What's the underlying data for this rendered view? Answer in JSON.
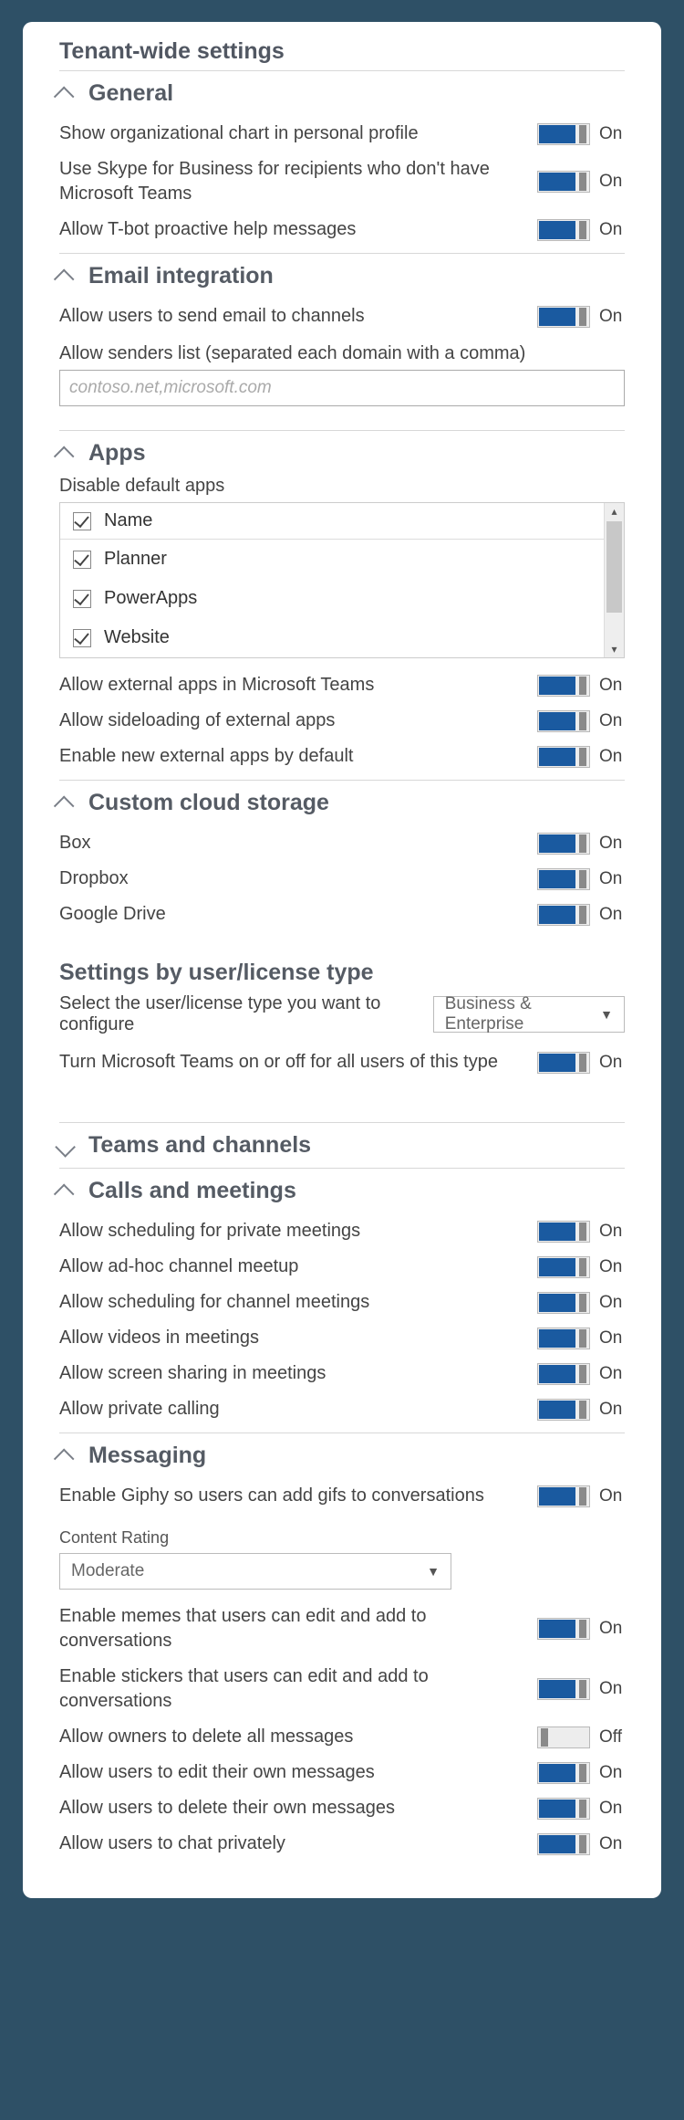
{
  "title": "Tenant-wide settings",
  "toggle_on_text": "On",
  "toggle_off_text": "Off",
  "sections": {
    "general": {
      "heading": "General",
      "items": [
        {
          "label": "Show organizational chart in personal profile",
          "state": "on"
        },
        {
          "label": "Use Skype for Business for recipients who don't have Microsoft Teams",
          "state": "on"
        },
        {
          "label": "Allow T-bot proactive help messages",
          "state": "on"
        }
      ]
    },
    "email": {
      "heading": "Email integration",
      "items": [
        {
          "label": "Allow users to send email to channels",
          "state": "on"
        }
      ],
      "senders_label": "Allow senders list (separated each domain with a comma)",
      "senders_placeholder": "contoso.net,microsoft.com"
    },
    "apps": {
      "heading": "Apps",
      "disable_label": "Disable default apps",
      "name_header": "Name",
      "list": [
        {
          "name": "Planner",
          "checked": true
        },
        {
          "name": "PowerApps",
          "checked": true
        },
        {
          "name": "Website",
          "checked": true
        }
      ],
      "items": [
        {
          "label": "Allow external apps in Microsoft Teams",
          "state": "on"
        },
        {
          "label": "Allow sideloading of external apps",
          "state": "on"
        },
        {
          "label": "Enable new external apps by default",
          "state": "on"
        }
      ]
    },
    "storage": {
      "heading": "Custom cloud storage",
      "items": [
        {
          "label": "Box",
          "state": "on"
        },
        {
          "label": "Dropbox",
          "state": "on"
        },
        {
          "label": "Google Drive",
          "state": "on"
        }
      ]
    },
    "bytype": {
      "heading": "Settings by user/license type",
      "select_label": "Select the user/license type you want to configure",
      "select_value": "Business & Enterprise",
      "items": [
        {
          "label": "Turn Microsoft Teams on or off for all users of this type",
          "state": "on"
        }
      ]
    },
    "teams": {
      "heading": "Teams and channels"
    },
    "calls": {
      "heading": "Calls and meetings",
      "items": [
        {
          "label": "Allow scheduling for private meetings",
          "state": "on"
        },
        {
          "label": "Allow ad-hoc channel meetup",
          "state": "on"
        },
        {
          "label": "Allow scheduling for channel meetings",
          "state": "on"
        },
        {
          "label": "Allow videos in meetings",
          "state": "on"
        },
        {
          "label": "Allow screen sharing in meetings",
          "state": "on"
        },
        {
          "label": "Allow private calling",
          "state": "on"
        }
      ]
    },
    "messaging": {
      "heading": "Messaging",
      "items_a": [
        {
          "label": "Enable Giphy so users can add gifs to conversations",
          "state": "on"
        }
      ],
      "rating_label": "Content Rating",
      "rating_value": "Moderate",
      "items_b": [
        {
          "label": "Enable memes that users can edit and add to conversations",
          "state": "on"
        },
        {
          "label": "Enable stickers that users can edit and add to conversations",
          "state": "on"
        },
        {
          "label": "Allow owners to delete all messages",
          "state": "off"
        },
        {
          "label": "Allow users to edit their own messages",
          "state": "on"
        },
        {
          "label": "Allow users to delete their own messages",
          "state": "on"
        },
        {
          "label": "Allow users to chat privately",
          "state": "on"
        }
      ]
    }
  }
}
